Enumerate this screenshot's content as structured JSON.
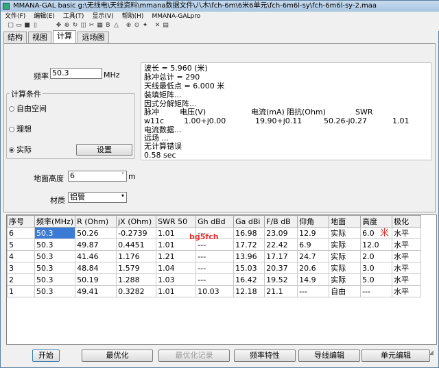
{
  "window": {
    "title": "MMANA-GAL basic g:\\无线电\\天线资料\\mmana数据文件\\八木\\fch-6m\\6米6单元\\fch-6m6l-sy\\fch-6m6l-sy-2.maa"
  },
  "menu": [
    "文件(F)",
    "编辑(E)",
    "工具(T)",
    "显示(V)",
    "帮助(H)",
    "MMANA-GALpro"
  ],
  "tabs": [
    "结构",
    "视图",
    "计算",
    "远场图"
  ],
  "params": {
    "freq_label": "频率",
    "freq_value": "50.3",
    "freq_unit": "MHz",
    "conditions_title": "计算条件",
    "radio_free": "自由空间",
    "radio_ideal": "理想",
    "radio_real": "实际",
    "settings_button": "设置",
    "height_label": "地面高度",
    "height_value": "6",
    "height_unit": "m",
    "material_label": "材质",
    "material_value": "铝管"
  },
  "results": {
    "wavelength": "波长 = 5.960 (米)",
    "pulses": "脉冲总计 = 290",
    "lowest": "天线最低点 = 6.000 米",
    "loading": "装填矩阵...",
    "factor": "因式分解矩阵...",
    "header": [
      "脉冲",
      "电压(V)",
      "电流(mA)",
      "阻抗(Ohm)",
      "SWR"
    ],
    "row": [
      "w11c",
      "1.00+j0.00",
      "19.90+j0.11",
      "50.26-j0.27",
      "1.01"
    ],
    "current_data": "电流数据...",
    "farfield": "远场 ...",
    "noerror": "无计算错误",
    "time": "0.58 sec"
  },
  "table": {
    "headers": [
      "序号",
      "频率(MHz)",
      "R (Ohm)",
      "jX (Ohm)",
      "SWR 50",
      "Gh dBd",
      "Ga dBi",
      "F/B dB",
      "仰角",
      "地面",
      "高度",
      "极化"
    ],
    "rows": [
      [
        "6",
        "50.3",
        "50.26",
        "-0.2739",
        "1.01",
        "---",
        "16.98",
        "23.09",
        "12.9",
        "实际",
        "6.0",
        "水平"
      ],
      [
        "5",
        "50.3",
        "49.87",
        "0.4451",
        "1.01",
        "---",
        "17.72",
        "22.42",
        "6.9",
        "实际",
        "12.0",
        "水平"
      ],
      [
        "4",
        "50.3",
        "41.46",
        "1.176",
        "1.21",
        "---",
        "13.96",
        "17.17",
        "24.7",
        "实际",
        "2.0",
        "水平"
      ],
      [
        "3",
        "50.3",
        "48.84",
        "1.579",
        "1.04",
        "---",
        "15.03",
        "20.37",
        "20.6",
        "实际",
        "3.0",
        "水平"
      ],
      [
        "2",
        "50.3",
        "50.19",
        "1.288",
        "1.03",
        "---",
        "16.42",
        "19.52",
        "14.9",
        "实际",
        "5.0",
        "水平"
      ],
      [
        "1",
        "50.3",
        "49.41",
        "0.3282",
        "1.01",
        "10.03",
        "12.18",
        "21.1",
        "---",
        "自由",
        "---",
        "水平"
      ]
    ],
    "watermark": "bg5fch",
    "star": "米"
  },
  "buttons": [
    "开始",
    "最优化",
    "最优化记录",
    "频率特性",
    "导线编辑",
    "单元编辑"
  ]
}
